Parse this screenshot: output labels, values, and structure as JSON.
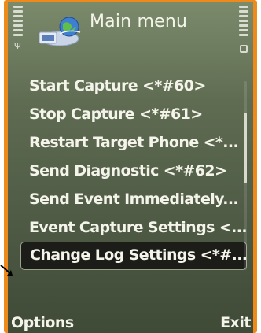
{
  "header": {
    "title": "Main menu",
    "app_icon": "globe-computer-icon"
  },
  "status": {
    "signal_icon": "signal-strength-icon",
    "battery_icon": "battery-icon"
  },
  "menu": {
    "items": [
      {
        "label": "Start Capture <*#60>"
      },
      {
        "label": "Stop Capture <*#61>"
      },
      {
        "label": "Restart Target Phone <*..."
      },
      {
        "label": "Send Diagnostic <*#62>"
      },
      {
        "label": "Send Event Immediately..."
      },
      {
        "label": "Event Capture Settings <..."
      },
      {
        "label": "Change Log Settings <*#..."
      }
    ],
    "selected_index": 6
  },
  "softkeys": {
    "left": "Options",
    "right": "Exit"
  },
  "colors": {
    "frame": "#ee8a19",
    "screen": "#5f6c52",
    "text": "#f4f4ea",
    "highlight": "#1c1c18"
  }
}
